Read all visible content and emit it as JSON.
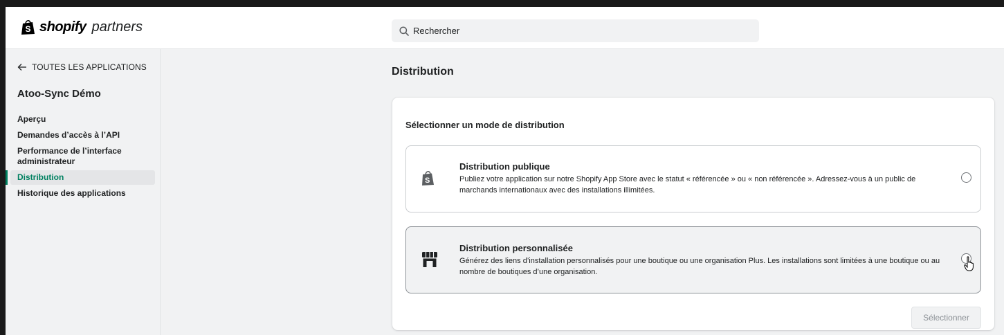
{
  "header": {
    "logo_word": "shopify",
    "logo_sub": "partners",
    "search_placeholder": "Rechercher"
  },
  "sidebar": {
    "back_label": "TOUTES LES APPLICATIONS",
    "app_name": "Atoo-Sync Démo",
    "items": [
      {
        "label": "Aperçu",
        "active": false
      },
      {
        "label": "Demandes d’accès à l’API",
        "active": false
      },
      {
        "label": "Performance de l’interface administrateur",
        "active": false
      },
      {
        "label": "Distribution",
        "active": true
      },
      {
        "label": "Historique des applications",
        "active": false
      }
    ]
  },
  "main": {
    "page_title": "Distribution",
    "card_title": "Sélectionner un mode de distribution",
    "options": [
      {
        "title": "Distribution publique",
        "description": "Publiez votre application sur notre Shopify App Store avec le statut « référencée » ou « non référencée ». Adressez-vous à un public de marchands internationaux avec des installations illimitées.",
        "icon": "shopify-bag-icon",
        "selected": false
      },
      {
        "title": "Distribution personnalisée",
        "description": "Générez des liens d’installation personnalisés pour une boutique ou une organisation Plus. Les installations sont limitées à une boutique ou au nombre de boutiques d’une organisation.",
        "icon": "store-icon",
        "selected": false,
        "hovered": true
      }
    ],
    "select_button": "Sélectionner",
    "select_button_disabled": true
  },
  "colors": {
    "accent": "#008060",
    "background": "#f1f2f3",
    "text": "#202223"
  }
}
